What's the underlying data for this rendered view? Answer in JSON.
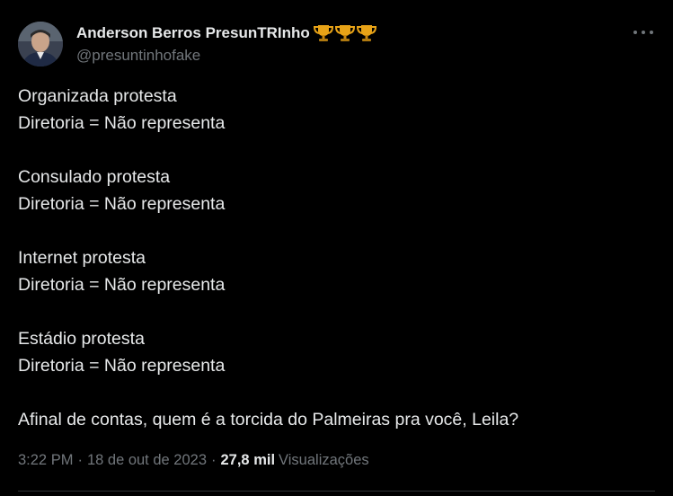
{
  "author": {
    "name": "Anderson Berros PresunTRInho",
    "handle": "@presuntinhofake",
    "badges": [
      "trophy-icon",
      "trophy-icon",
      "trophy-icon"
    ]
  },
  "tweet": {
    "lines": [
      "Organizada protesta",
      "Diretoria = Não representa",
      "Consulado protesta",
      "Diretoria = Não representa",
      "Internet protesta",
      "Diretoria = Não representa",
      "Estádio protesta",
      "Diretoria = Não representa",
      "Afinal de contas, quem é a torcida do Palmeiras pra você, Leila?"
    ]
  },
  "meta": {
    "time": "3:22 PM",
    "date": "18 de out de 2023",
    "views_count": "27,8 mil",
    "views_label": "Visualizações",
    "separator": "·"
  },
  "colors": {
    "background": "#000000",
    "text": "#e7e9ea",
    "secondary": "#71767b",
    "trophy": "#e8a317"
  }
}
